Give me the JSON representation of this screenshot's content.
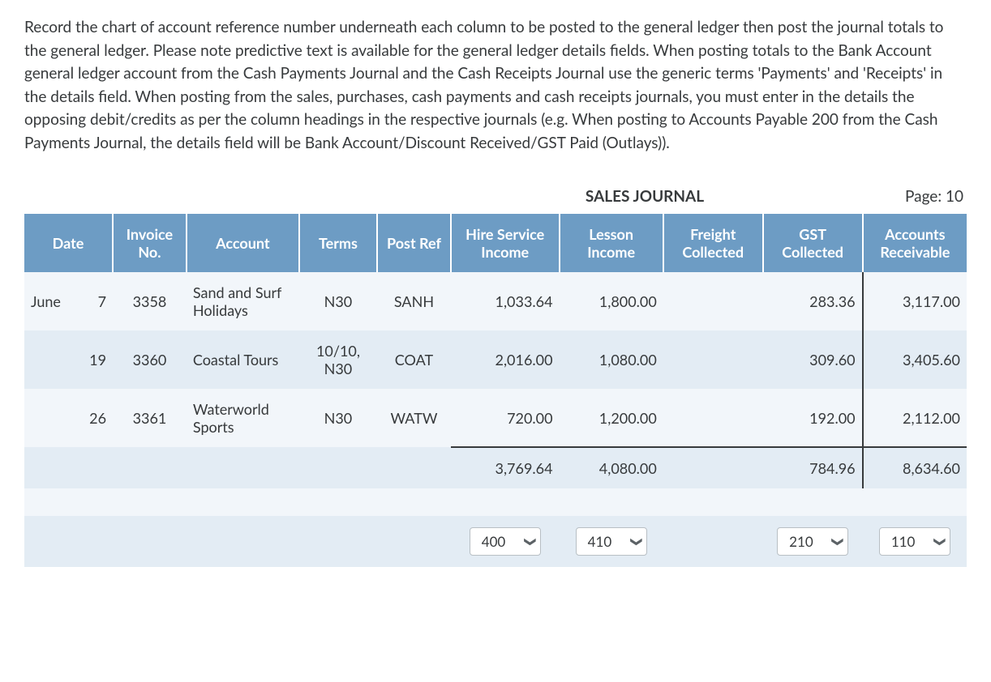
{
  "instructions": "Record the chart of account reference number underneath each column to be posted to the general ledger then post the journal totals to the general ledger. Please note predictive text is available for the general ledger details fields. When posting totals to the Bank Account general ledger account from the Cash Payments Journal and the Cash Receipts Journal use the generic terms 'Payments' and 'Receipts' in the details field. When posting from the sales, purchases, cash payments and cash receipts journals, you must enter in the details the opposing debit/credits as per the column headings in the respective journals (e.g. When posting to Accounts Payable 200 from the Cash Payments Journal, the details field will be Bank Account/Discount Received/GST Paid (Outlays)).",
  "journal": {
    "title": "SALES JOURNAL",
    "page_label": "Page: 10",
    "headers": {
      "date": "Date",
      "invoice_no": "Invoice No.",
      "account": "Account",
      "terms": "Terms",
      "post_ref": "Post Ref",
      "hire_service_income": "Hire Service Income",
      "lesson_income": "Lesson Income",
      "freight_collected": "Freight Collected",
      "gst_collected": "GST Collected",
      "accounts_receivable": "Accounts Receivable"
    },
    "rows": [
      {
        "month": "June",
        "day": "7",
        "invoice_no": "3358",
        "account": "Sand and Surf Holidays",
        "terms": "N30",
        "post_ref": "SANH",
        "hire_service_income": "1,033.64",
        "lesson_income": "1,800.00",
        "freight_collected": "",
        "gst_collected": "283.36",
        "accounts_receivable": "3,117.00"
      },
      {
        "month": "",
        "day": "19",
        "invoice_no": "3360",
        "account": "Coastal Tours",
        "terms": "10/10, N30",
        "post_ref": "COAT",
        "hire_service_income": "2,016.00",
        "lesson_income": "1,080.00",
        "freight_collected": "",
        "gst_collected": "309.60",
        "accounts_receivable": "3,405.60"
      },
      {
        "month": "",
        "day": "26",
        "invoice_no": "3361",
        "account": "Waterworld Sports",
        "terms": "N30",
        "post_ref": "WATW",
        "hire_service_income": "720.00",
        "lesson_income": "1,200.00",
        "freight_collected": "",
        "gst_collected": "192.00",
        "accounts_receivable": "2,112.00"
      }
    ],
    "totals": {
      "hire_service_income": "3,769.64",
      "lesson_income": "4,080.00",
      "freight_collected": "",
      "gst_collected": "784.96",
      "accounts_receivable": "8,634.60"
    },
    "refs": {
      "hire_service_income": "400",
      "lesson_income": "410",
      "gst_collected": "210",
      "accounts_receivable": "110"
    }
  },
  "chart_data": {
    "type": "table",
    "title": "SALES JOURNAL",
    "page": 10,
    "columns": [
      "Date",
      "Invoice No.",
      "Account",
      "Terms",
      "Post Ref",
      "Hire Service Income",
      "Lesson Income",
      "Freight Collected",
      "GST Collected",
      "Accounts Receivable"
    ],
    "rows": [
      [
        "June 7",
        "3358",
        "Sand and Surf Holidays",
        "N30",
        "SANH",
        1033.64,
        1800.0,
        null,
        283.36,
        3117.0
      ],
      [
        "June 19",
        "3360",
        "Coastal Tours",
        "10/10, N30",
        "COAT",
        2016.0,
        1080.0,
        null,
        309.6,
        3405.6
      ],
      [
        "June 26",
        "3361",
        "Waterworld Sports",
        "N30",
        "WATW",
        720.0,
        1200.0,
        null,
        192.0,
        2112.0
      ]
    ],
    "totals": {
      "Hire Service Income": 3769.64,
      "Lesson Income": 4080.0,
      "Freight Collected": null,
      "GST Collected": 784.96,
      "Accounts Receivable": 8634.6
    },
    "reference_numbers": {
      "Hire Service Income": 400,
      "Lesson Income": 410,
      "GST Collected": 210,
      "Accounts Receivable": 110
    }
  }
}
